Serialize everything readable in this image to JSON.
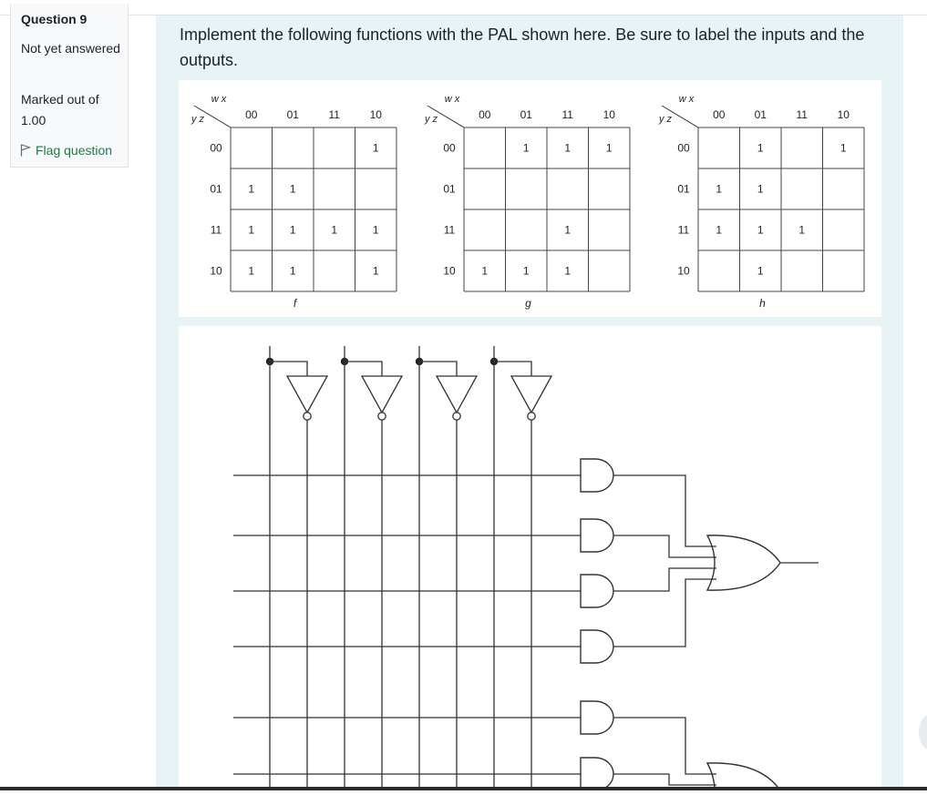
{
  "question_info": {
    "number_label": "Question 9",
    "state": "Not yet answered",
    "grade": "Marked out of 1.00",
    "flag_label": "Flag question"
  },
  "question": {
    "text": "Implement the following functions with the PAL shown here. Be sure to label the inputs and the outputs."
  },
  "kmaps": {
    "col_var": "w x",
    "row_var": "y z",
    "col_labels": [
      "00",
      "01",
      "11",
      "10"
    ],
    "row_labels": [
      "00",
      "01",
      "11",
      "10"
    ],
    "maps": [
      {
        "name": "f",
        "cells": [
          [
            "",
            "",
            "",
            "1"
          ],
          [
            "1",
            "1",
            "",
            ""
          ],
          [
            "1",
            "1",
            "1",
            "1"
          ],
          [
            "1",
            "1",
            "",
            "1"
          ]
        ]
      },
      {
        "name": "g",
        "cells": [
          [
            "",
            "1",
            "1",
            "1"
          ],
          [
            "",
            "",
            "",
            ""
          ],
          [
            "",
            "",
            "1",
            ""
          ],
          [
            "1",
            "1",
            "1",
            ""
          ]
        ]
      },
      {
        "name": "h",
        "cells": [
          [
            "",
            "1",
            "",
            "1"
          ],
          [
            "1",
            "1",
            "",
            ""
          ],
          [
            "1",
            "1",
            "1",
            ""
          ],
          [
            "",
            "1",
            "",
            ""
          ]
        ]
      }
    ]
  },
  "pal": {
    "input_count": 4,
    "and_gate_count": 6,
    "or_gate_count": 2
  },
  "colors": {
    "link_green": "#1c7a44",
    "content_bg": "#e7f3f5",
    "info_bg": "#f8f9fa"
  }
}
